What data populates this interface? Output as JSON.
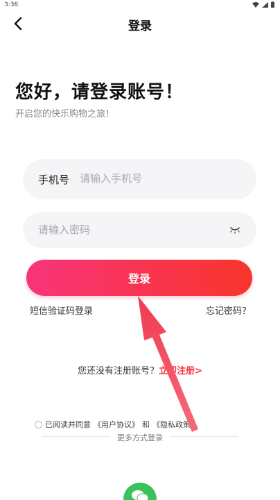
{
  "status_bar": {
    "time": "3:36",
    "icons": [
      "wifi-icon",
      "signal-icon",
      "battery-icon"
    ]
  },
  "nav": {
    "title": "登录",
    "back_icon": "chevron-left-icon"
  },
  "greeting": {
    "title": "您好，请登录账号！",
    "subtitle": "开启您的快乐购物之旅！"
  },
  "form": {
    "phone_prefix": "手机号",
    "phone_placeholder": "请输入手机号",
    "phone_value": "",
    "password_placeholder": "请输入密码",
    "password_value": "",
    "password_toggle_icon": "eye-closed-icon"
  },
  "actions": {
    "login_label": "登录",
    "sms_login_label": "短信验证码登录",
    "forgot_password_label": "忘记密码？"
  },
  "register": {
    "prompt": "您还没有注册账号？",
    "link_label": "立即注册>"
  },
  "agreement": {
    "prefix": "已阅读并同意",
    "user_agreement": "《用户协议》",
    "and": "和",
    "privacy_policy": "《隐私政策》",
    "checked": false
  },
  "more_login": {
    "label": "更多方式登录",
    "wechat_icon": "wechat-icon"
  },
  "colors": {
    "accent_start": "#f8347a",
    "accent_end": "#f8352b",
    "register_link": "#f4334a",
    "wechat": "#3cc25d",
    "annotation_arrow": "#f23a52"
  }
}
